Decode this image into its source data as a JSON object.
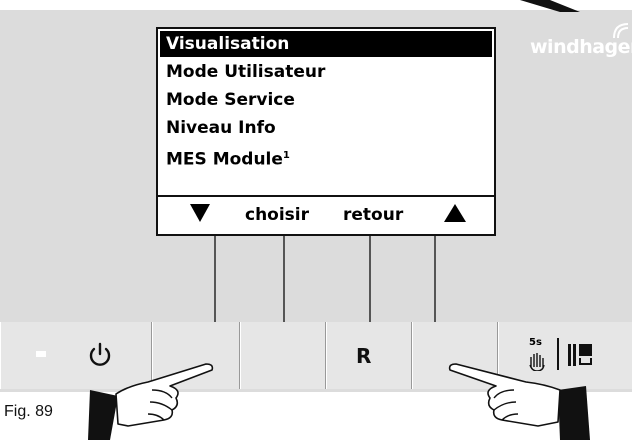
{
  "brand": "windhager",
  "menu": {
    "items": [
      {
        "label": "Visualisation",
        "selected": true
      },
      {
        "label": "Mode Utilisateur",
        "selected": false
      },
      {
        "label": "Mode Service",
        "selected": false
      },
      {
        "label": "Niveau Info",
        "selected": false
      },
      {
        "label": "MES Module",
        "sup": "1",
        "selected": false
      }
    ]
  },
  "softkeys": {
    "down": "down-arrow-icon",
    "choose": "choisir",
    "back": "retour",
    "up": "up-arrow-icon"
  },
  "buttons": {
    "reset_label": "R",
    "hold_label": "5s"
  },
  "figure_label": "Fig. 89",
  "colors": {
    "panel": "#dcdcdc",
    "button": "#e6e6e6",
    "selected_bg": "#000000",
    "brand_text": "#ffffff"
  }
}
